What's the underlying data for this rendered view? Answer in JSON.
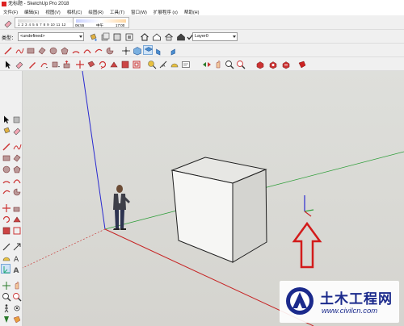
{
  "window": {
    "title": "无标题 - SketchUp Pro 2018"
  },
  "menu": [
    "文件(F)",
    "编辑(E)",
    "视图(V)",
    "相机(C)",
    "绘图(R)",
    "工具(T)",
    "窗口(W)",
    "扩展程序 (x)",
    "帮助(H)"
  ],
  "scene_tabs": [
    "1",
    "2",
    "3",
    "4",
    "5",
    "6",
    "7",
    "8",
    "9",
    "10",
    "11",
    "12"
  ],
  "time_marks": [
    "06:55",
    "中午",
    "17:00"
  ],
  "entity_info": {
    "label": "类型：",
    "value": "<undefined>"
  },
  "layer_combo": {
    "value": "Layer0",
    "checked": true
  },
  "axes_colors": {
    "red": "#c62424",
    "green": "#2f9e3a",
    "blue": "#2a2ad0"
  },
  "annotation_arrow_color": "#d21b1b",
  "watermark": {
    "title": "土木工程网",
    "url": "www.civilcn.com"
  }
}
